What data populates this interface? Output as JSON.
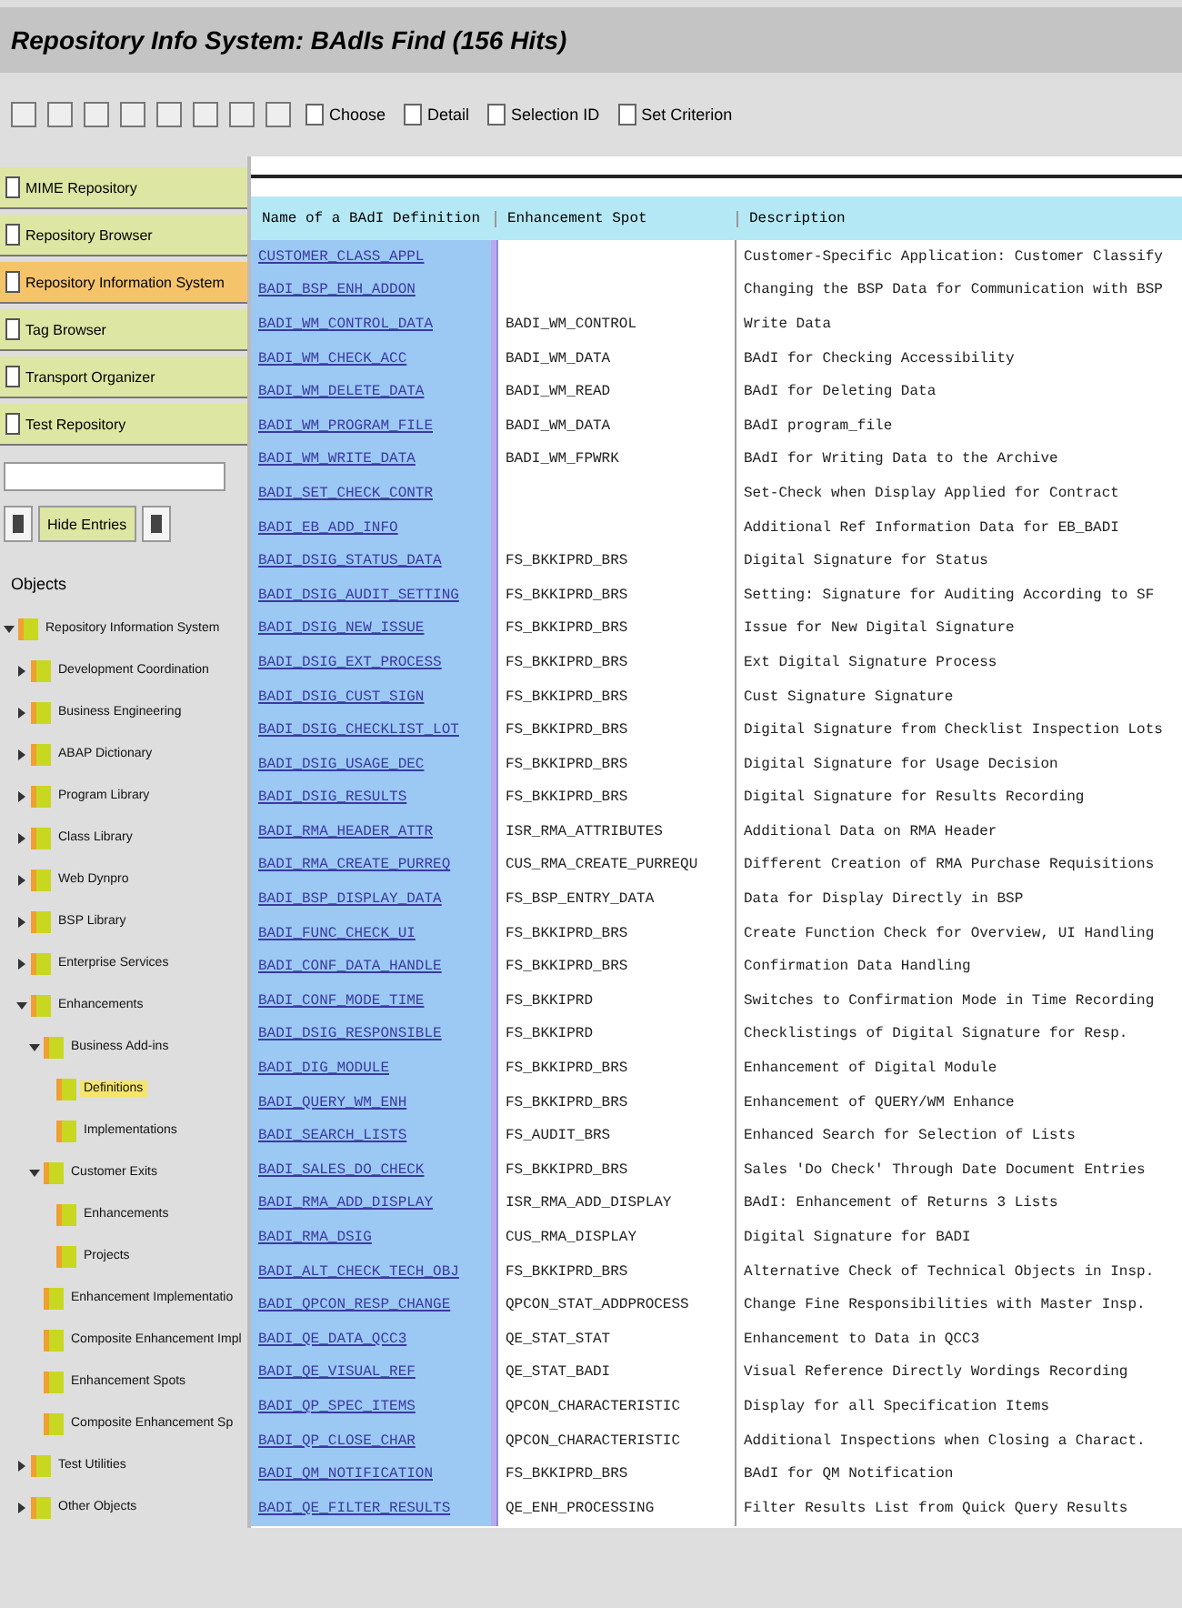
{
  "window": {
    "title": "Repository Info System: BAdIs Find (156 Hits)"
  },
  "toolbar": {
    "buttons": [
      "Choose",
      "Detail",
      "Selection ID",
      "Set Criterion"
    ]
  },
  "nav": [
    {
      "label": "MIME Repository",
      "selected": false
    },
    {
      "label": "Repository Browser",
      "selected": false
    },
    {
      "label": "Repository Information System",
      "selected": true
    },
    {
      "label": "Tag Browser",
      "selected": false
    },
    {
      "label": "Transport Organizer",
      "selected": false
    },
    {
      "label": "Test Repository",
      "selected": false
    }
  ],
  "filter_button": "Hide Entries",
  "tree_label": "Objects",
  "tree": [
    {
      "label": "Repository Information System",
      "expanded": true,
      "selected": false,
      "children": [
        {
          "label": "Development Coordination",
          "expanded": false,
          "selected": false
        },
        {
          "label": "Business Engineering",
          "expanded": false,
          "selected": false
        },
        {
          "label": "ABAP Dictionary",
          "expanded": false,
          "selected": false
        },
        {
          "label": "Program Library",
          "expanded": false,
          "selected": false
        },
        {
          "label": "Class Library",
          "expanded": false,
          "selected": false
        },
        {
          "label": "Web Dynpro",
          "expanded": false,
          "selected": false
        },
        {
          "label": "BSP Library",
          "expanded": false,
          "selected": false
        },
        {
          "label": "Enterprise Services",
          "expanded": false,
          "selected": false
        },
        {
          "label": "Enhancements",
          "expanded": true,
          "selected": false,
          "children": [
            {
              "label": "Business Add-ins",
              "expanded": true,
              "selected": false,
              "children": [
                {
                  "label": "Definitions",
                  "selected": true
                },
                {
                  "label": "Implementations",
                  "selected": false
                }
              ]
            },
            {
              "label": "Customer Exits",
              "expanded": true,
              "selected": false,
              "children": [
                {
                  "label": "Enhancements",
                  "selected": false
                },
                {
                  "label": "Projects",
                  "selected": false
                }
              ]
            },
            {
              "label": "Enhancement Implementatio",
              "selected": false
            },
            {
              "label": "Composite Enhancement Impl",
              "selected": false
            },
            {
              "label": "Enhancement Spots",
              "selected": false
            },
            {
              "label": "Composite Enhancement Sp",
              "selected": false
            }
          ]
        },
        {
          "label": "Test Utilities",
          "expanded": false,
          "selected": false
        },
        {
          "label": "Other Objects",
          "expanded": false,
          "selected": false
        }
      ]
    }
  ],
  "table": {
    "columns": [
      "Name of a BAdI Definition",
      "Enhancement Spot",
      "Description"
    ],
    "rows": [
      [
        "CUSTOMER_CLASS_APPL",
        "",
        "Customer-Specific Application: Customer Classify"
      ],
      [
        "BADI_BSP_ENH_ADDON",
        "",
        "Changing the BSP Data for Communication with BSP"
      ],
      [
        "BADI_WM_CONTROL_DATA",
        "BADI_WM_CONTROL",
        "Write Data"
      ],
      [
        "BADI_WM_CHECK_ACC",
        "BADI_WM_DATA",
        "BAdI for Checking Accessibility"
      ],
      [
        "BADI_WM_DELETE_DATA",
        "BADI_WM_READ",
        "BAdI for Deleting Data"
      ],
      [
        "BADI_WM_PROGRAM_FILE",
        "BADI_WM_DATA",
        "BAdI program_file"
      ],
      [
        "BADI_WM_WRITE_DATA",
        "BADI_WM_FPWRK",
        "BAdI for Writing Data to the Archive"
      ],
      [
        "BADI_SET_CHECK_CONTR",
        "",
        "Set-Check when Display Applied for Contract"
      ],
      [
        "BADI_EB_ADD_INFO",
        "",
        "Additional Ref Information Data for EB_BADI"
      ],
      [
        "BADI_DSIG_STATUS_DATA",
        "FS_BKKIPRD_BRS",
        "Digital Signature for Status"
      ],
      [
        "BADI_DSIG_AUDIT_SETTING",
        "FS_BKKIPRD_BRS",
        "Setting: Signature for Auditing According to SF"
      ],
      [
        "BADI_DSIG_NEW_ISSUE",
        "FS_BKKIPRD_BRS",
        "Issue for New Digital Signature"
      ],
      [
        "BADI_DSIG_EXT_PROCESS",
        "FS_BKKIPRD_BRS",
        "Ext Digital Signature Process"
      ],
      [
        "BADI_DSIG_CUST_SIGN",
        "FS_BKKIPRD_BRS",
        "Cust Signature Signature"
      ],
      [
        "BADI_DSIG_CHECKLIST_LOT",
        "FS_BKKIPRD_BRS",
        "Digital Signature from Checklist Inspection Lots"
      ],
      [
        "BADI_DSIG_USAGE_DEC",
        "FS_BKKIPRD_BRS",
        "Digital Signature for Usage Decision"
      ],
      [
        "BADI_DSIG_RESULTS",
        "FS_BKKIPRD_BRS",
        "Digital Signature for Results Recording"
      ],
      [
        "BADI_RMA_HEADER_ATTR",
        "ISR_RMA_ATTRIBUTES",
        "Additional Data on RMA Header"
      ],
      [
        "BADI_RMA_CREATE_PURREQ",
        "CUS_RMA_CREATE_PURREQU",
        "Different Creation of RMA Purchase Requisitions"
      ],
      [
        "BADI_BSP_DISPLAY_DATA",
        "FS_BSP_ENTRY_DATA",
        "Data for Display Directly in BSP"
      ],
      [
        "BADI_FUNC_CHECK_UI",
        "FS_BKKIPRD_BRS",
        "Create Function Check for Overview, UI Handling"
      ],
      [
        "BADI_CONF_DATA_HANDLE",
        "FS_BKKIPRD_BRS",
        "Confirmation Data Handling"
      ],
      [
        "BADI_CONF_MODE_TIME",
        "FS_BKKIPRD",
        "Switches to Confirmation Mode in Time Recording"
      ],
      [
        "BADI_DSIG_RESPONSIBLE",
        "FS_BKKIPRD",
        "Checklistings of Digital Signature for Resp."
      ],
      [
        "BADI_DIG_MODULE",
        "FS_BKKIPRD_BRS",
        "Enhancement of Digital Module"
      ],
      [
        "BADI_QUERY_WM_ENH",
        "FS_BKKIPRD_BRS",
        "Enhancement of QUERY/WM Enhance"
      ],
      [
        "BADI_SEARCH_LISTS",
        "FS_AUDIT_BRS",
        "Enhanced Search for Selection of Lists"
      ],
      [
        "BADI_SALES_DO_CHECK",
        "FS_BKKIPRD_BRS",
        "Sales 'Do Check' Through Date Document Entries"
      ],
      [
        "BADI_RMA_ADD_DISPLAY",
        "ISR_RMA_ADD_DISPLAY",
        "BAdI: Enhancement of Returns 3 Lists"
      ],
      [
        "BADI_RMA_DSIG",
        "CUS_RMA_DISPLAY",
        "Digital Signature for BADI"
      ],
      [
        "BADI_ALT_CHECK_TECH_OBJ",
        "FS_BKKIPRD_BRS",
        "Alternative Check of Technical Objects in Insp."
      ],
      [
        "BADI_QPCON_RESP_CHANGE",
        "QPCON_STAT_ADDPROCESS",
        "Change Fine Responsibilities with Master Insp."
      ],
      [
        "BADI_QE_DATA_QCC3",
        "QE_STAT_STAT",
        "Enhancement to Data in QCC3"
      ],
      [
        "BADI_QE_VISUAL_REF",
        "QE_STAT_BADI",
        "Visual Reference Directly Wordings Recording"
      ],
      [
        "BADI_QP_SPEC_ITEMS",
        "QPCON_CHARACTERISTIC",
        "Display for all Specification Items"
      ],
      [
        "BADI_QP_CLOSE_CHAR",
        "QPCON_CHARACTERISTIC",
        "Additional Inspections when Closing a Charact."
      ],
      [
        "BADI_QM_NOTIFICATION",
        "FS_BKKIPRD_BRS",
        "BAdI for QM Notification"
      ],
      [
        "BADI_QE_FILTER_RESULTS",
        "QE_ENH_PROCESSING",
        "Filter Results List from Quick Query Results"
      ]
    ]
  }
}
